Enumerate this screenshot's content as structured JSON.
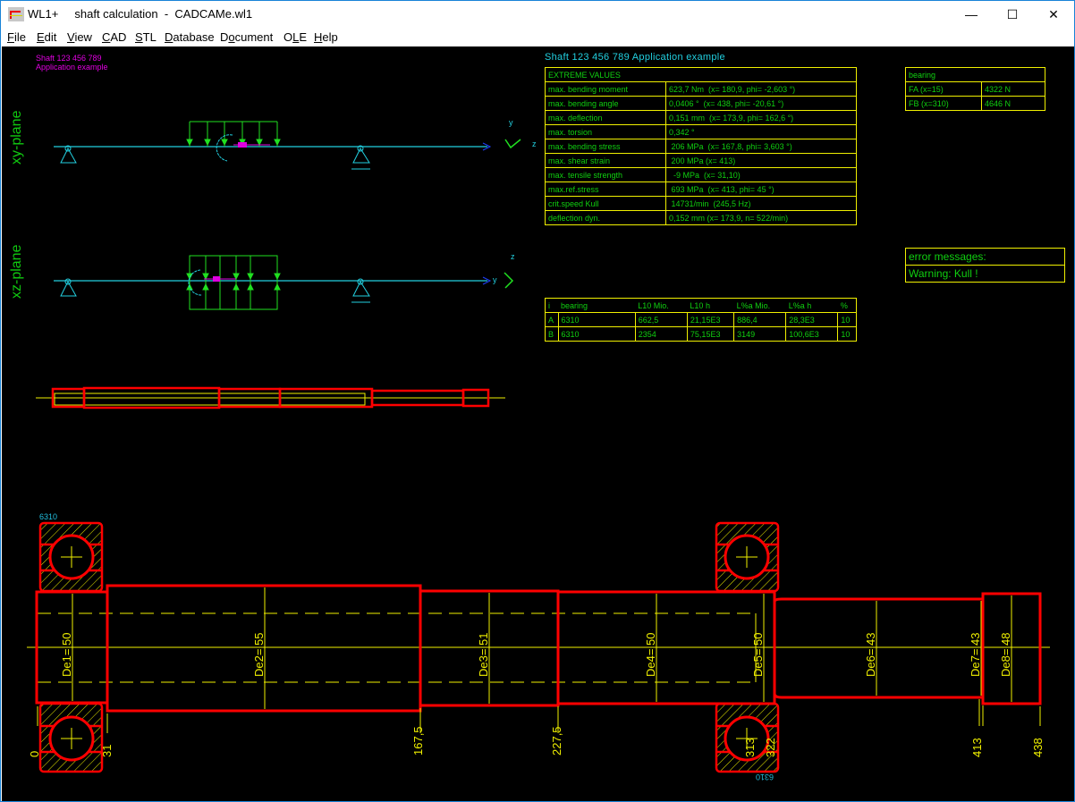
{
  "window": {
    "app_name": "WL1+",
    "title": "shaft calculation  -  CADCAMe.wl1",
    "controls": {
      "minimize": "—",
      "maximize": "☐",
      "close": "✕"
    }
  },
  "menu": [
    {
      "label": "File",
      "mnemonic": "F"
    },
    {
      "label": "Edit",
      "mnemonic": "E"
    },
    {
      "label": "View",
      "mnemonic": "V"
    },
    {
      "label": "CAD",
      "mnemonic": "C"
    },
    {
      "label": "STL",
      "mnemonic": "S"
    },
    {
      "label": "Database",
      "mnemonic": "D"
    },
    {
      "label": "Document",
      "mnemonic": "o"
    },
    {
      "label": "OLE",
      "mnemonic": "L"
    },
    {
      "label": "Help",
      "mnemonic": "H"
    }
  ],
  "drawing": {
    "header_line1": "Shaft  123 456 789",
    "header_line2": "Application example",
    "sheet_title": "Shaft 123 456 789  Application example",
    "xy_plane_label": "xy-plane",
    "xz_plane_label": "xz-plane",
    "axes_xy": {
      "y": "y",
      "z": "z"
    },
    "axes_xz": {
      "z": "z",
      "y": "y"
    },
    "colors": {
      "background": "#000000",
      "shaft_outline": "#ff0000",
      "dimension": "#f0f000",
      "text_green": "#10d010",
      "axis_cyan": "#22d0e0",
      "load_green": "#20e020",
      "moment_magenta": "#e000e0"
    }
  },
  "extreme_values": {
    "header": "EXTREME VALUES",
    "rows": [
      {
        "label": "max. bending moment",
        "value": "623,7 Nm  (x= 180,9, phi= -2,603 °)"
      },
      {
        "label": "max. bending angle",
        "value": "0,0406 °  (x= 438, phi= -20,61 °)"
      },
      {
        "label": "max. deflection",
        "value": "0,151 mm  (x= 173,9, phi= 162,6 °)"
      },
      {
        "label": "max. torsion",
        "value": "0,342 °"
      },
      {
        "label": "max. bending stress",
        "value": " 206 MPa  (x= 167,8, phi= 3,603 °)"
      },
      {
        "label": "max. shear strain",
        "value": " 200 MPa (x= 413)"
      },
      {
        "label": "max. tensile strength",
        "value": "  -9 MPa  (x= 31,10)"
      },
      {
        "label": "max.ref.stress",
        "value": " 693 MPa  (x= 413, phi= 45 °)"
      },
      {
        "label": "crit.speed Kull",
        "value": " 14731/min  (245,5 Hz)"
      },
      {
        "label": "deflection dyn.",
        "value": "0,152 mm (x= 173,9, n= 522/min)"
      }
    ]
  },
  "bearing_forces": {
    "header": "bearing",
    "rows": [
      {
        "label": "FA (x=15)",
        "value": "4322 N"
      },
      {
        "label": "FB (x=310)",
        "value": "4646 N"
      }
    ]
  },
  "errors": {
    "header": "error messages:",
    "message": "Warning: Kull !"
  },
  "bearing_life": {
    "columns": [
      "i",
      "bearing",
      "L10 Mio.",
      "L10 h",
      "L%a Mio.",
      "L%a h",
      "%"
    ],
    "rows": [
      [
        "A",
        "6310",
        "662,5",
        "21,15E3",
        "886,4",
        "28,3E3",
        "10"
      ],
      [
        "B",
        "6310",
        "2354",
        "75,15E3",
        "3149",
        "100,6E3",
        "10"
      ]
    ]
  },
  "shaft": {
    "bearing_left_label": "6310",
    "bearing_right_label": "6310",
    "diameters": [
      {
        "label": "De1= 50"
      },
      {
        "label": "De2= 55"
      },
      {
        "label": "De3= 51"
      },
      {
        "label": "De4= 50"
      },
      {
        "label": "De5= 50"
      },
      {
        "label": "De6= 43"
      },
      {
        "label": "De7= 43"
      },
      {
        "label": "De8= 48"
      }
    ],
    "positions": [
      "0",
      "31",
      "167,5",
      "227,5",
      "313",
      "322",
      "413",
      "438"
    ]
  }
}
